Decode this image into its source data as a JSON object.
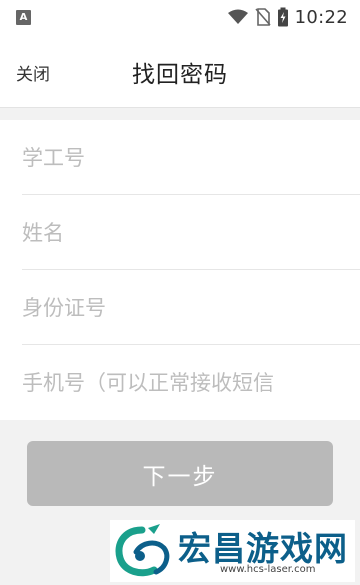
{
  "status_bar": {
    "app_icon_letter": "A",
    "time": "10:22"
  },
  "header": {
    "close_label": "关闭",
    "title": "找回密码"
  },
  "form": {
    "fields": [
      {
        "placeholder": "学工号",
        "value": ""
      },
      {
        "placeholder": "姓名",
        "value": ""
      },
      {
        "placeholder": "身份证号",
        "value": ""
      },
      {
        "placeholder": "手机号（可以正常接收短信",
        "value": ""
      }
    ]
  },
  "next_button_label": "下一步",
  "watermark": {
    "brand": "宏昌游戏网",
    "url": "www.hcs-laser.com"
  },
  "colors": {
    "header_bg": "#ffffff",
    "page_bg": "#f2f2f2",
    "button_disabled": "#b9b9b9",
    "watermark_text": "#0c5f8a",
    "watermark_accent": "#1aa08c"
  },
  "icons": [
    "app-a-icon",
    "wifi-icon",
    "no-sim-icon",
    "battery-icon",
    "watermark-logo-icon"
  ]
}
